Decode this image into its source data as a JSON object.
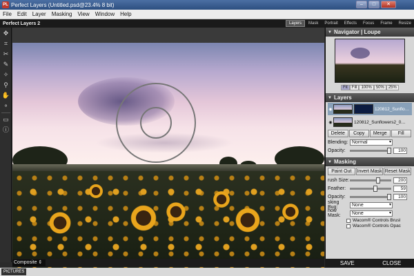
{
  "window": {
    "title": "Perfect Layers (Untitled.psd@23.4% 8 bit)",
    "app_icon": "PL",
    "controls": [
      "–",
      "□",
      "✕"
    ]
  },
  "menu": [
    "File",
    "Edit",
    "Layer",
    "Masking",
    "View",
    "Window",
    "Help"
  ],
  "app": {
    "logo": "Perfect Layers 2",
    "modes": [
      "Layers",
      "Mask",
      "Portrait",
      "Effects",
      "Focus",
      "Frame",
      "Resize"
    ],
    "active_mode": "Layers"
  },
  "tools": [
    "move-icon",
    "crop-icon",
    "transform-icon",
    "brush-icon",
    "magic-brush-icon",
    "eyedropper-icon",
    "hand-icon",
    "zoom-icon",
    "compare-icon",
    "info-icon"
  ],
  "canvas": {
    "view_mode": "Composite ⇕"
  },
  "status": {
    "caption": "PICTURES"
  },
  "navigator": {
    "title": "Navigator | Loupe",
    "zoom_buttons": [
      "Fit",
      "Fill",
      "100%",
      "50%",
      "25%"
    ],
    "active_zoom": "Fit"
  },
  "layers": {
    "title": "Layers",
    "items": [
      {
        "name": "120812_Sunflo…",
        "selected": true,
        "has_mask": true
      },
      {
        "name": "120812_Sunflowers2_0…",
        "selected": false,
        "has_mask": false
      }
    ],
    "buttons": [
      "Delete",
      "Copy",
      "Merge",
      "Fill"
    ],
    "blending_label": "Blending:",
    "blending_value": "Normal",
    "opacity_label": "Opacity:",
    "opacity_value": "100"
  },
  "masking": {
    "title": "Masking",
    "buttons": [
      "Paint Out",
      "Invert Mask",
      "Reset Mask"
    ],
    "brush_size_label": "rush Size:",
    "brush_size_value": "200",
    "feather_label": "Feather:",
    "feather_value": "59",
    "opacity_label": "Opacity:",
    "opacity_value": "100",
    "masking_bug_label": "sking Bug:",
    "masking_bug_value": "None",
    "show_mask_label": "how Mask:",
    "show_mask_value": "None",
    "checkbox1": "Wacom® Controls Brusl",
    "checkbox2": "Wacom® Controls Opac"
  },
  "footer": {
    "save": "SAVE",
    "close": "CLOSE"
  }
}
